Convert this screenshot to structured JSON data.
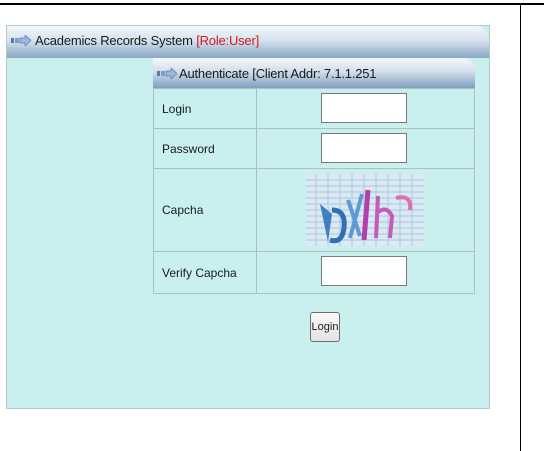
{
  "window": {
    "title": "Academics Records System",
    "role_tag": "[Role:User]",
    "title_icon": "arrow-icon"
  },
  "auth_panel": {
    "header": "Authenticate  [Client Addr: 7.1.1.251",
    "header_icon": "arrow-icon",
    "fields": {
      "login_label": "Login",
      "login_value": "",
      "password_label": "Password",
      "password_value": "",
      "captcha_label": "Capcha",
      "captcha_text": "DXIH",
      "verify_label": "Verify Capcha",
      "verify_value": ""
    },
    "login_button": "Login"
  },
  "colors": {
    "panel_bg": "#c9efef",
    "titlebar_dark": "#8aa7c4",
    "role_red": "#d41a1a"
  }
}
